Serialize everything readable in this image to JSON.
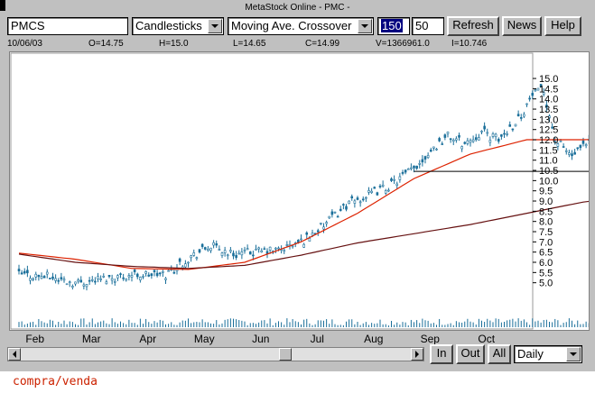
{
  "window": {
    "title": "MetaStock Online - PMC -"
  },
  "toolbar": {
    "symbol": "PMCS",
    "chart_style": "Candlesticks",
    "indicator": "Moving Ave. Crossover",
    "period_1": "150",
    "period_2": "50",
    "refresh_label": "Refresh",
    "news_label": "News",
    "help_label": "Help"
  },
  "quote": {
    "date": "10/06/03",
    "open": "O=14.75",
    "high": "H=15.0",
    "low": "L=14.65",
    "close": "C=14.99",
    "volume": "V=1366961.0",
    "indicator": "I=10.746"
  },
  "controls": {
    "in_label": "In",
    "out_label": "Out",
    "all_label": "All",
    "interval": "Daily"
  },
  "footer": {
    "text": "compra/venda"
  },
  "colors": {
    "candles": "#1a6f9a",
    "ma_fast": "#dd2200",
    "ma_slow": "#661111",
    "trendlines": "#000000",
    "volume": "#1a6f9a",
    "footer": "#cc2200"
  },
  "chart_data": {
    "type": "line",
    "y_ticks": [
      5.0,
      5.5,
      6.0,
      6.5,
      7.0,
      7.5,
      8.0,
      8.5,
      9.0,
      9.5,
      10.0,
      10.5,
      11.0,
      11.5,
      12.0,
      12.5,
      13.0,
      13.5,
      14.0,
      14.5,
      15.0
    ],
    "ylim": [
      4.5,
      15.4
    ],
    "x_ticks": [
      "Feb",
      "Mar",
      "Apr",
      "May",
      "Jun",
      "Jul",
      "Aug",
      "Sep",
      "Oct"
    ],
    "grid": false,
    "price_points": [
      [
        0,
        5.4
      ],
      [
        0.5,
        5.3
      ],
      [
        1,
        5.0
      ],
      [
        1.5,
        5.2
      ],
      [
        2,
        5.4
      ],
      [
        2.6,
        5.4
      ],
      [
        3,
        6.2
      ],
      [
        3.4,
        6.8
      ],
      [
        3.8,
        6.4
      ],
      [
        4.2,
        6.5
      ],
      [
        4.6,
        6.6
      ],
      [
        5,
        7.0
      ],
      [
        5.4,
        7.8
      ],
      [
        5.8,
        8.8
      ],
      [
        6.2,
        9.3
      ],
      [
        6.6,
        9.8
      ],
      [
        7,
        10.6
      ],
      [
        7.3,
        11.5
      ],
      [
        7.6,
        12.2
      ],
      [
        7.9,
        11.8
      ],
      [
        8.2,
        12.4
      ],
      [
        8.5,
        12.0
      ],
      [
        8.9,
        13.2
      ],
      [
        9.1,
        14.2
      ],
      [
        9.3,
        14.4
      ],
      [
        9.5,
        12.0
      ],
      [
        9.8,
        11.2
      ],
      [
        10.1,
        11.8
      ],
      [
        10.4,
        12.3
      ],
      [
        10.7,
        10.8
      ],
      [
        11.0,
        10.6
      ],
      [
        11.3,
        11.7
      ],
      [
        11.6,
        12.5
      ],
      [
        12.0,
        12.8
      ],
      [
        12.3,
        14.3
      ],
      [
        12.6,
        14.5
      ],
      [
        12.9,
        13.6
      ],
      [
        13.2,
        14.0
      ],
      [
        13.5,
        13.8
      ],
      [
        13.8,
        13.0
      ],
      [
        14.1,
        13.6
      ],
      [
        14.4,
        14.8
      ]
    ],
    "series": [
      {
        "values": [
          [
            0,
            6.45
          ],
          [
            1,
            6.15
          ],
          [
            2,
            5.7
          ],
          [
            3,
            5.65
          ],
          [
            4,
            6.0
          ],
          [
            5,
            7.0
          ],
          [
            6,
            8.4
          ],
          [
            7,
            10.1
          ],
          [
            8,
            11.3
          ],
          [
            9,
            12.0
          ],
          [
            10,
            12.0
          ],
          [
            11,
            12.1
          ],
          [
            12,
            12.6
          ],
          [
            13,
            12.8
          ],
          [
            13.7,
            12.9
          ],
          [
            14.4,
            13.05
          ]
        ]
      },
      {
        "values": [
          [
            0,
            6.4
          ],
          [
            1,
            6.0
          ],
          [
            2,
            5.8
          ],
          [
            3,
            5.7
          ],
          [
            4,
            5.85
          ],
          [
            5,
            6.35
          ],
          [
            6,
            6.95
          ],
          [
            7,
            7.4
          ],
          [
            8,
            7.85
          ],
          [
            9,
            8.4
          ],
          [
            10,
            8.95
          ],
          [
            11,
            9.3
          ],
          [
            12,
            9.85
          ],
          [
            13,
            10.3
          ],
          [
            14.4,
            10.75
          ]
        ]
      }
    ],
    "reference_lines": [
      {
        "y": 14.95,
        "x_from": 10.5,
        "x_to": 14.5
      },
      {
        "y": 10.45,
        "x_from": 7.0,
        "x_to": 14.5
      }
    ]
  }
}
